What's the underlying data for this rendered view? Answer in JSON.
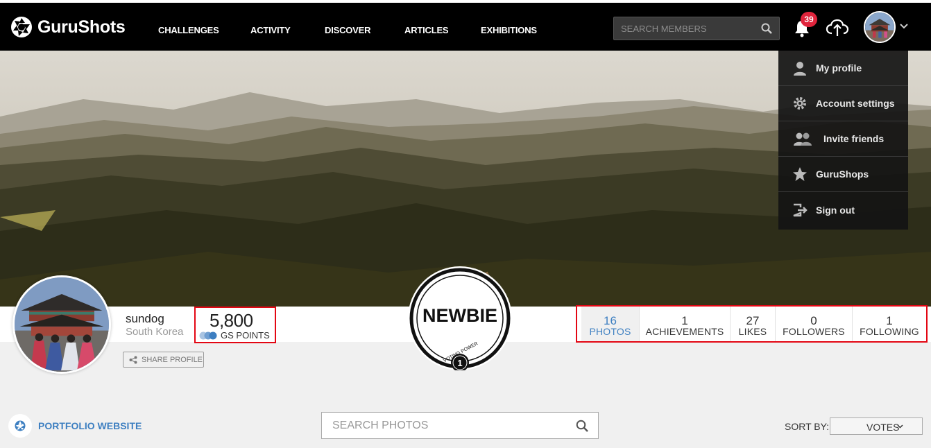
{
  "app": {
    "name": "GuruShots"
  },
  "nav": {
    "items": [
      "CHALLENGES",
      "ACTIVITY",
      "DISCOVER",
      "ARTICLES",
      "EXHIBITIONS"
    ],
    "search_placeholder": "SEARCH MEMBERS",
    "notification_count": "39"
  },
  "menu": {
    "items": [
      {
        "label": "My profile",
        "icon": "user-icon"
      },
      {
        "label": "Account settings",
        "icon": "gear-icon"
      },
      {
        "label": "Invite friends",
        "icon": "users-icon"
      },
      {
        "label": "GuruShops",
        "icon": "star-icon"
      },
      {
        "label": "Sign out",
        "icon": "sign-out-icon"
      }
    ]
  },
  "profile": {
    "username": "sundog",
    "country": "South Korea",
    "points": "5,800",
    "points_label": "GS POINTS",
    "share_label": "SHARE PROFILE",
    "level": "NEWBIE",
    "voting_power_label": "VOTING POWER",
    "voting_power": "1"
  },
  "stats": [
    {
      "value": "16",
      "label": "PHOTOS",
      "active": true
    },
    {
      "value": "1",
      "label": "ACHIEVEMENTS"
    },
    {
      "value": "27",
      "label": "LIKES"
    },
    {
      "value": "0",
      "label": "FOLLOWERS"
    },
    {
      "value": "1",
      "label": "FOLLOWING"
    }
  ],
  "toolbar": {
    "portfolio_label": "PORTFOLIO WEBSITE",
    "search_placeholder": "SEARCH PHOTOS",
    "sort_label": "SORT BY:",
    "sort_value": "VOTES"
  },
  "colors": {
    "accent": "#3d7fc1",
    "badge_red": "#e0243c",
    "highlight_border": "#e30613"
  }
}
